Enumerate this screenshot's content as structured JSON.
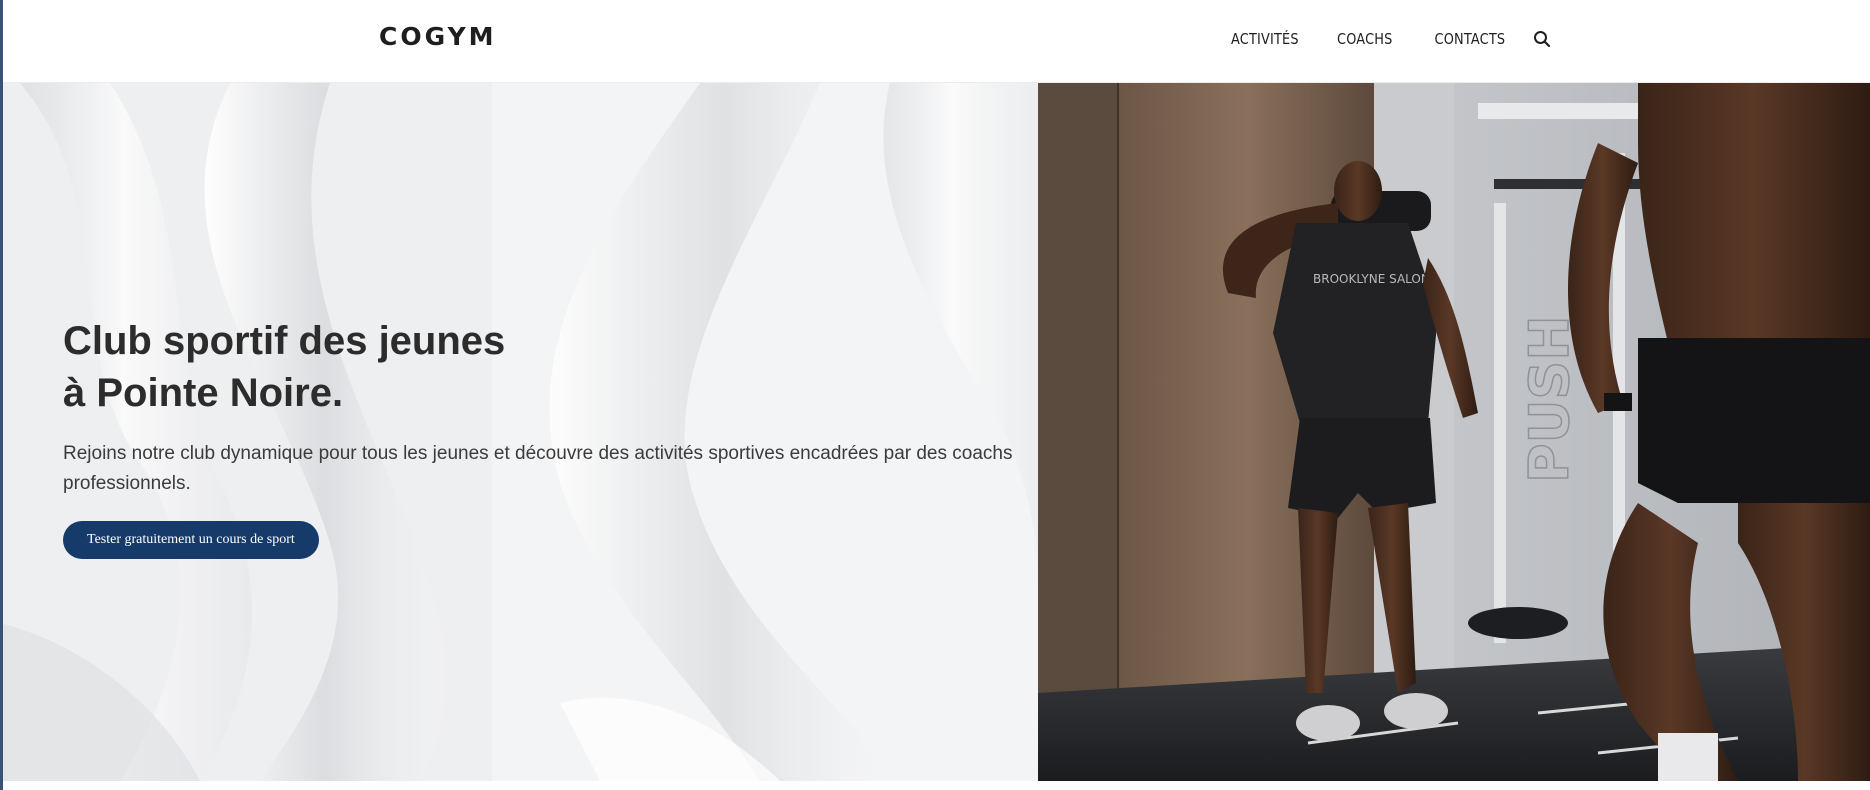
{
  "brand": {
    "logo": "COGYM"
  },
  "nav": {
    "items": [
      {
        "label": "ACTIVITÉS"
      },
      {
        "label": "COACHS"
      },
      {
        "label": "CONTACTS"
      }
    ],
    "search_icon": "search-icon"
  },
  "hero": {
    "title_line1": "Club sportif des jeunes",
    "title_line2": "à Pointe Noire.",
    "subtitle": "Rejoins notre club dynamique pour tous les jeunes et découvre des activités sportives encadrées par des coachs professionnels.",
    "cta_label": "Tester gratuitement un cours de sport",
    "photo_wall_text": "PUSH",
    "shirt_text": "BROOKLYNE SALON"
  },
  "colors": {
    "accent": "#163a6a",
    "text_dark": "#2c2c2c",
    "edge": "#3a5278"
  }
}
